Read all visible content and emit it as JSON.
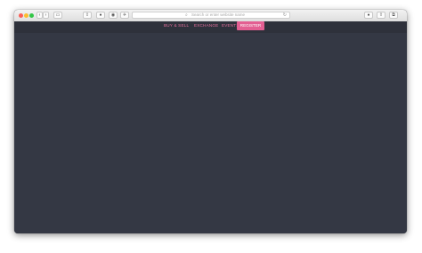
{
  "browser": {
    "address_placeholder": "Search or enter website name",
    "icons": [
      "back-icon",
      "forward-icon",
      "sidebar-icon",
      "share-icon",
      "shield-icon",
      "history-icon",
      "extension-icon",
      "reload-icon",
      "info-icon",
      "upload-icon",
      "tabs-icon"
    ]
  },
  "nav": {
    "items": [
      {
        "label": "BUY & SELL"
      },
      {
        "label": "EXCHANGE"
      },
      {
        "label": "EVENTS"
      }
    ],
    "register_label": "REGISTER"
  },
  "colors": {
    "page_bg": "#343844",
    "nav_bg": "#2e313b",
    "accent": "#e35f92",
    "nav_text": "#e8719e"
  }
}
